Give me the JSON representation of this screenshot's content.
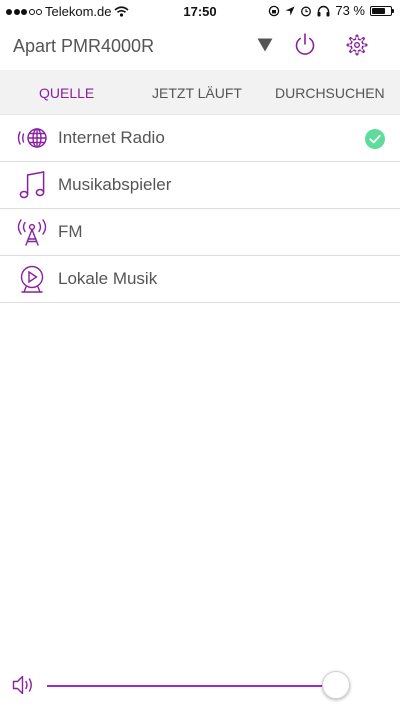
{
  "status_bar": {
    "carrier": "Telekom.de",
    "time": "17:50",
    "battery": "73 %",
    "battery_level": 0.73,
    "signal_bars": 3
  },
  "header": {
    "device_name": "Apart PMR4000R"
  },
  "tabs": [
    {
      "label": "QUELLE",
      "active": true
    },
    {
      "label": "JETZT LÄUFT",
      "active": false
    },
    {
      "label": "DURCHSUCHEN",
      "active": false
    }
  ],
  "sources": [
    {
      "label": "Internet Radio",
      "icon": "globe-radio-icon",
      "selected": true
    },
    {
      "label": "Musikabspieler",
      "icon": "music-note-icon",
      "selected": false
    },
    {
      "label": "FM",
      "icon": "radio-tower-icon",
      "selected": false
    },
    {
      "label": "Lokale Musik",
      "icon": "play-circle-icon",
      "selected": false
    }
  ],
  "volume": {
    "level": 0.99
  },
  "colors": {
    "accent": "#8a1fa0",
    "check": "#5fdc9b"
  }
}
